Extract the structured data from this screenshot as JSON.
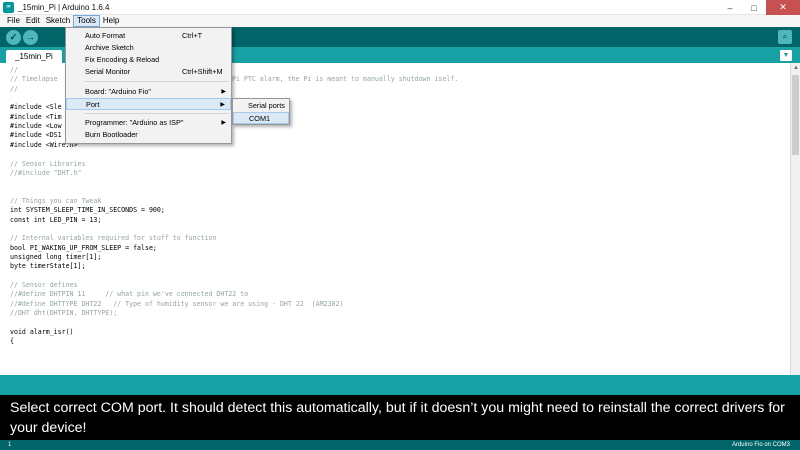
{
  "window": {
    "title": "_15min_Pi | Arduino 1.6.4",
    "app_icon": "∞",
    "minimize": "–",
    "maximize": "□",
    "close": "✕"
  },
  "menubar": [
    "File",
    "Edit",
    "Sketch",
    "Tools",
    "Help"
  ],
  "toolbar": {
    "verify": "✓",
    "upload": "→",
    "serial_monitor": "⌕"
  },
  "tab": {
    "name": "_15min_Pi",
    "menu_arrow": "▼"
  },
  "tools_menu": {
    "items": [
      {
        "label": "Auto Format",
        "shortcut": "Ctrl+T"
      },
      {
        "label": "Archive Sketch",
        "shortcut": ""
      },
      {
        "label": "Fix Encoding & Reload",
        "shortcut": ""
      },
      {
        "label": "Serial Monitor",
        "shortcut": "Ctrl+Shift+M"
      },
      {
        "label": "Board: \"Arduino Fio\"",
        "shortcut": "",
        "submenu": "▶"
      },
      {
        "label": "Port",
        "shortcut": "",
        "submenu": "▶"
      },
      {
        "label": "Programmer: \"Arduino as ISP\"",
        "shortcut": "",
        "submenu": "▶"
      },
      {
        "label": "Burn Bootloader",
        "shortcut": ""
      }
    ]
  },
  "port_submenu": {
    "header": "Serial ports",
    "items": [
      "COM1"
    ]
  },
  "code": [
    {
      "text": "//",
      "cls": "c-comment"
    },
    {
      "text": "// Timelapse",
      "cls": "c-comment",
      "tail": "Pi PTC alarm, the Pi is meant to manually shutdown iself."
    },
    {
      "text": "//",
      "cls": "c-comment"
    },
    {
      "text": "",
      "cls": "c-normal"
    },
    {
      "text": "#include <Sle",
      "cls": "c-normal"
    },
    {
      "text": "#include <Tim",
      "cls": "c-normal"
    },
    {
      "text": "#include <Low",
      "cls": "c-normal"
    },
    {
      "text": "#include <DS1",
      "cls": "c-normal"
    },
    {
      "text": "#include <Wire.h>",
      "cls": "c-normal"
    },
    {
      "text": "",
      "cls": "c-normal"
    },
    {
      "text": "// Sensor Libraries",
      "cls": "c-comment"
    },
    {
      "text": "//#include \"DHT.h\"",
      "cls": "c-comment"
    },
    {
      "text": "",
      "cls": "c-normal"
    },
    {
      "text": "",
      "cls": "c-normal"
    },
    {
      "text": "// Things you can Tweak",
      "cls": "c-comment"
    },
    {
      "text": "int SYSTEM_SLEEP_TIME_IN_SECONDS = 900;",
      "cls": "c-normal"
    },
    {
      "text": "const int LED_PIN = 13;",
      "cls": "c-normal"
    },
    {
      "text": "",
      "cls": "c-normal"
    },
    {
      "text": "// Internal variables required for stuff to function",
      "cls": "c-comment"
    },
    {
      "text": "bool PI_WAKING_UP_FROM_SLEEP = false;",
      "cls": "c-normal"
    },
    {
      "text": "unsigned long timer[1];",
      "cls": "c-normal"
    },
    {
      "text": "byte timerState[1];",
      "cls": "c-normal"
    },
    {
      "text": "",
      "cls": "c-normal"
    },
    {
      "text": "// Sensor defines",
      "cls": "c-comment"
    },
    {
      "text": "//#define DHTPIN 11     // what pin we've connected DHT22 to",
      "cls": "c-comment"
    },
    {
      "text": "//#define DHTTYPE DHT22   // Type of humidity sensor we are using - DHT 22  (AM2302)",
      "cls": "c-comment"
    },
    {
      "text": "//DHT dht(DHTPIN, DHTTYPE);",
      "cls": "c-comment"
    },
    {
      "text": "",
      "cls": "c-normal"
    },
    {
      "text": "void alarm_isr()",
      "cls": "c-normal"
    },
    {
      "text": "{",
      "cls": "c-normal"
    }
  ],
  "caption": "Select correct COM port. It should detect this automatically, but if it doesn’t you might need to reinstall the correct drivers for your device!",
  "status": {
    "line": "1",
    "board": "Arduino Fio on COM3"
  }
}
